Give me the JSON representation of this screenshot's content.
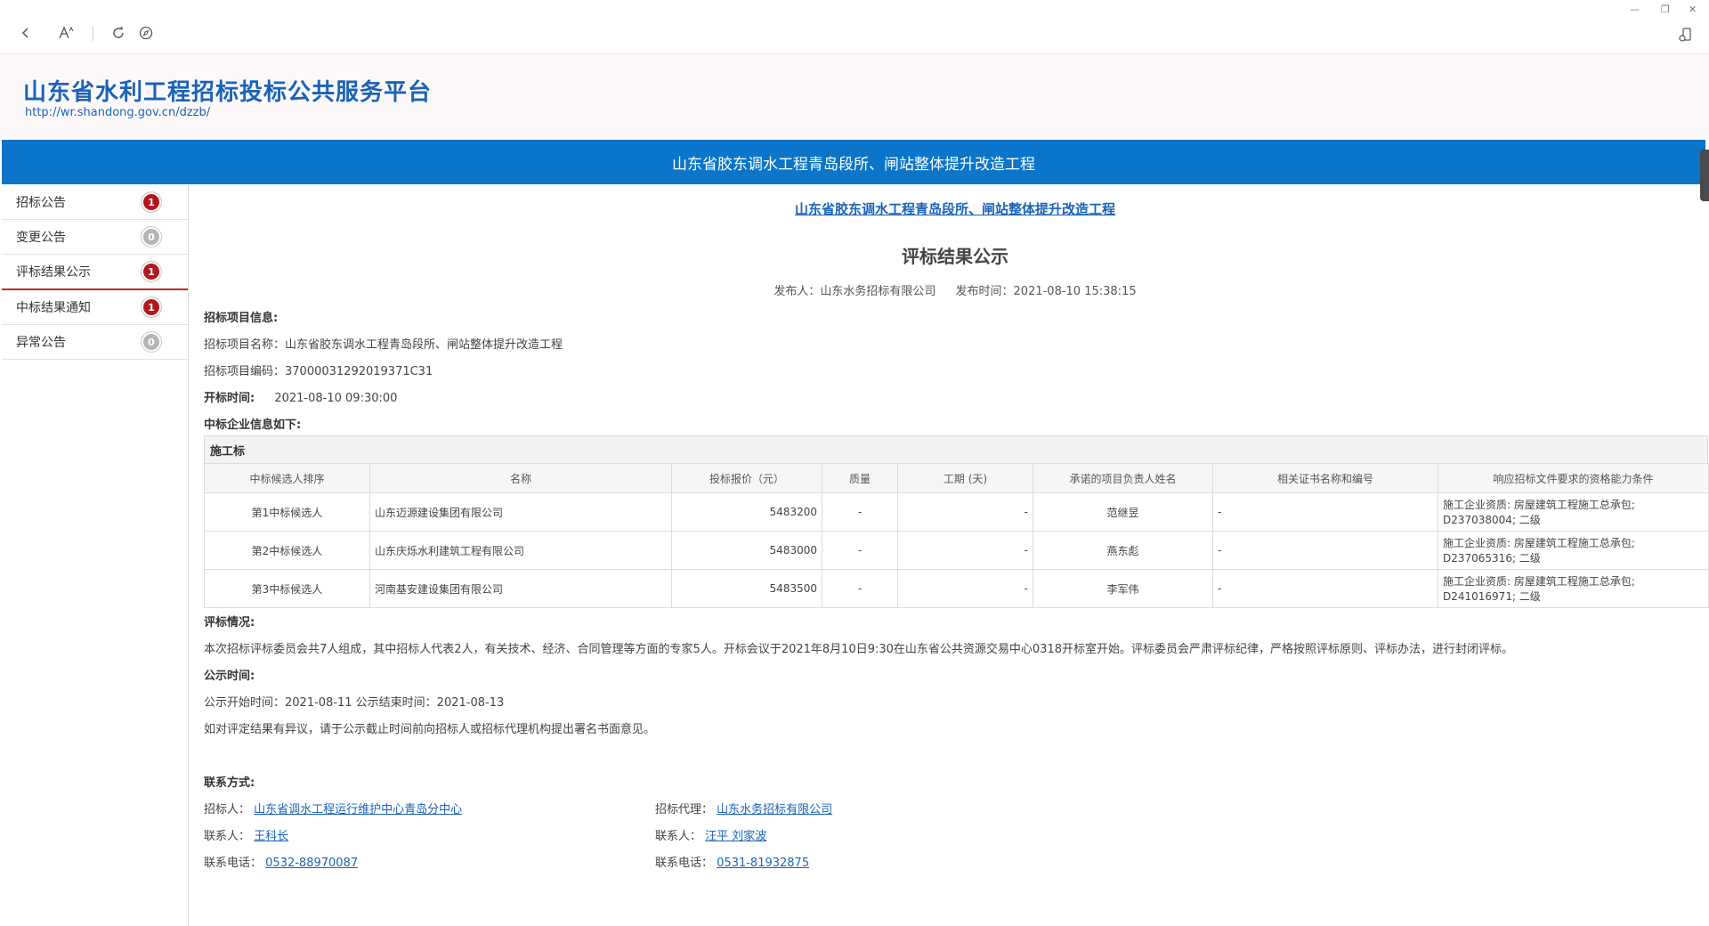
{
  "site": {
    "title": "山东省水利工程招标投标公共服务平台",
    "url": "http://wr.shandong.gov.cn/dzzb/"
  },
  "banner": {
    "title": "山东省胶东调水工程青岛段所、闸站整体提升改造工程"
  },
  "sidebar": {
    "items": [
      {
        "label": "招标公告",
        "count": "1",
        "badge": "red"
      },
      {
        "label": "变更公告",
        "count": "0",
        "badge": "gray"
      },
      {
        "label": "评标结果公示",
        "count": "1",
        "badge": "red"
      },
      {
        "label": "中标结果通知",
        "count": "1",
        "badge": "red"
      },
      {
        "label": "异常公告",
        "count": "0",
        "badge": "gray"
      }
    ]
  },
  "doc": {
    "project_link": "山东省胶东调水工程青岛段所、闸站整体提升改造工程",
    "title": "评标结果公示",
    "publisher": "发布人：山东水务招标有限公司",
    "publish_time": "发布时间：2021-08-10 15:38:15",
    "project_info_heading": "招标项目信息:",
    "project_name": "招标项目名称：山东省胶东调水工程青岛段所、闸站整体提升改造工程",
    "project_code": "招标项目编码：37000031292019371C31",
    "open_time_label": "开标时间:",
    "open_time_value": "2021-08-10 09:30:00",
    "winner_heading": "中标企业信息如下:",
    "table": {
      "caption": "施工标",
      "headers": [
        "中标候选人排序",
        "名称",
        "投标报价（元）",
        "质量",
        "工期 (天)",
        "承诺的项目负责人姓名",
        "相关证书名称和编号",
        "响应招标文件要求的资格能力条件"
      ],
      "rows": [
        [
          "第1中标候选人",
          "山东迈源建设集团有限公司",
          "5483200",
          "-",
          "-",
          "范继昱",
          "-",
          "施工企业资质: 房屋建筑工程施工总承包; D237038004; 二级"
        ],
        [
          "第2中标候选人",
          "山东庆烁水利建筑工程有限公司",
          "5483000",
          "-",
          "-",
          "燕东彪",
          "-",
          "施工企业资质: 房屋建筑工程施工总承包; D237065316; 二级"
        ],
        [
          "第3中标候选人",
          "河南基安建设集团有限公司",
          "5483500",
          "-",
          "-",
          "李军伟",
          "-",
          "施工企业资质: 房屋建筑工程施工总承包; D241016971; 二级"
        ]
      ]
    },
    "eval_heading": "评标情况:",
    "eval_text": "本次招标评标委员会共7人组成，其中招标人代表2人，有关技术、经济、合同管理等方面的专家5人。开标会议于2021年8月10日9:30在山东省公共资源交易中心0318开标室开始。评标委员会严肃评标纪律，严格按照评标原则、评标办法，进行封闭评标。",
    "notice_heading": "公示时间:",
    "notice_time": "公示开始时间：2021-08-11  公示结束时间：2021-08-13",
    "objection": "如对评定结果有异议，请于公示截止时间前向招标人或招标代理机构提出署名书面意见。",
    "contact_heading": "联系方式:",
    "tenderer_label": "招标人：",
    "tenderer": "山东省调水工程运行维护中心青岛分中心",
    "agent_label": "招标代理：",
    "agent": "山东水务招标有限公司",
    "contact_label": "联系人：",
    "tenderer_contact": "王科长",
    "agent_contact": "汪平 刘家波",
    "phone_label": "联系电话：",
    "tenderer_phone": "0532-88970087",
    "agent_phone": "0531-81932875"
  }
}
